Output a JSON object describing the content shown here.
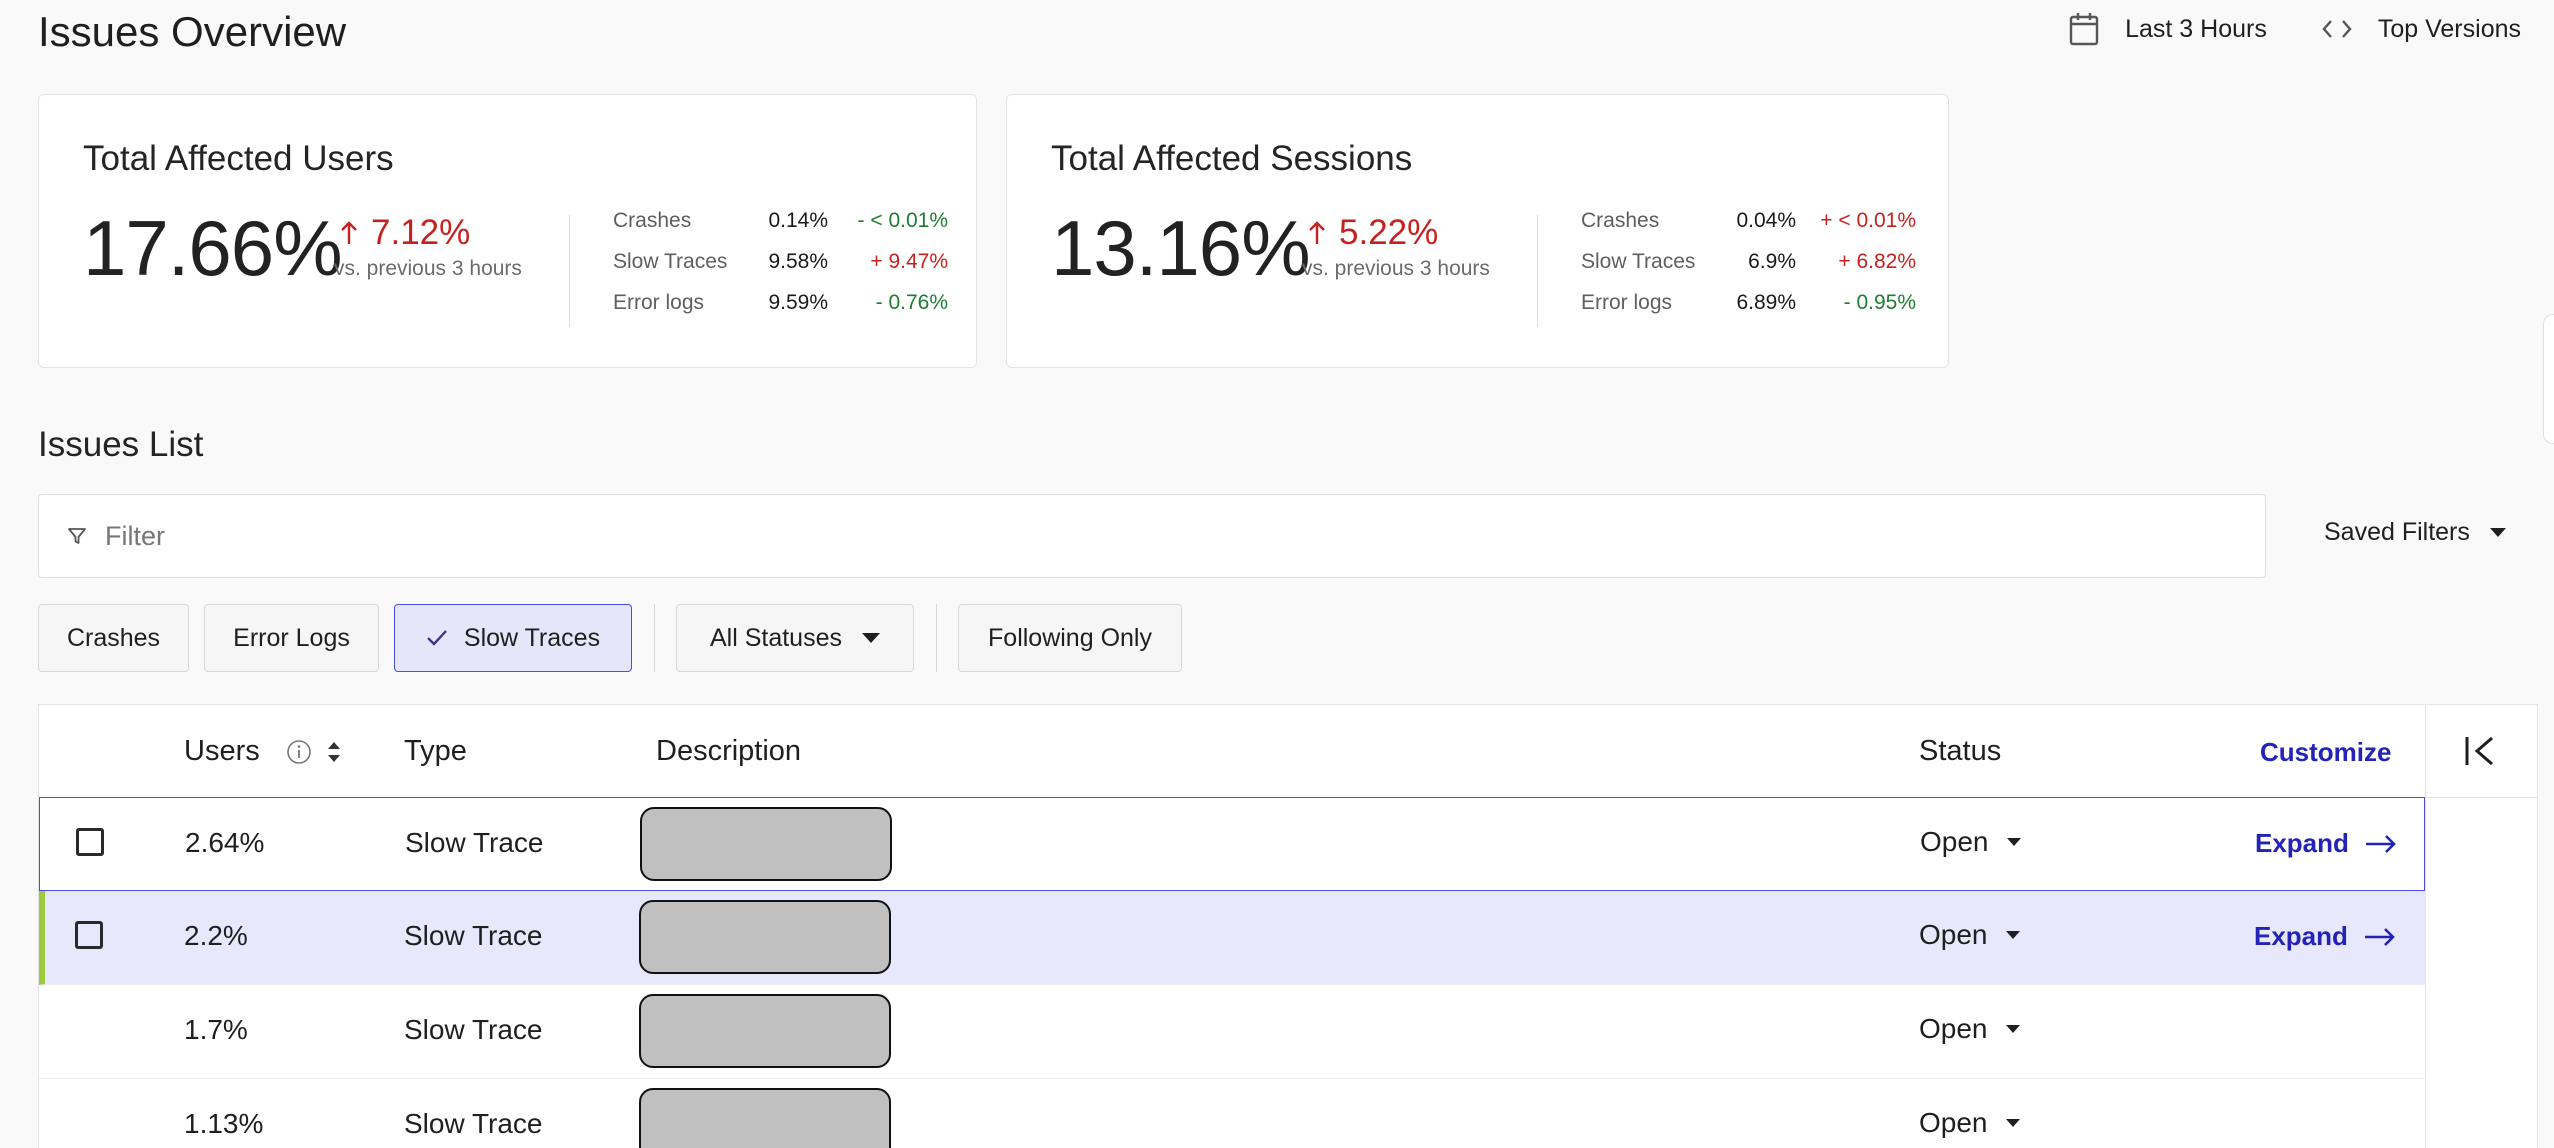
{
  "header": {
    "title": "Issues Overview",
    "time_range": "Last 3 Hours",
    "versions": "Top Versions"
  },
  "cards": [
    {
      "title": "Total Affected Users",
      "value": "17.66%",
      "delta": "7.12%",
      "delta_direction": "up",
      "comparison": "vs. previous 3 hours",
      "breakdown": [
        {
          "label": "Crashes",
          "value": "0.14%",
          "change": "- < 0.01%",
          "trend": "down"
        },
        {
          "label": "Slow Traces",
          "value": "9.58%",
          "change": "+ 9.47%",
          "trend": "up"
        },
        {
          "label": "Error logs",
          "value": "9.59%",
          "change": "- 0.76%",
          "trend": "down"
        }
      ]
    },
    {
      "title": "Total Affected Sessions",
      "value": "13.16%",
      "delta": "5.22%",
      "delta_direction": "up",
      "comparison": "vs. previous 3 hours",
      "breakdown": [
        {
          "label": "Crashes",
          "value": "0.04%",
          "change": "+ < 0.01%",
          "trend": "up"
        },
        {
          "label": "Slow Traces",
          "value": "6.9%",
          "change": "+ 6.82%",
          "trend": "up"
        },
        {
          "label": "Error logs",
          "value": "6.89%",
          "change": "- 0.95%",
          "trend": "down"
        }
      ]
    }
  ],
  "issues": {
    "title": "Issues List",
    "filter_placeholder": "Filter",
    "saved_filters": "Saved Filters",
    "chips": {
      "crashes": "Crashes",
      "error_logs": "Error Logs",
      "slow_traces": "Slow Traces",
      "all_statuses": "All Statuses",
      "following_only": "Following Only"
    },
    "columns": {
      "users": "Users",
      "type": "Type",
      "description": "Description",
      "status": "Status",
      "customize": "Customize"
    },
    "rows": [
      {
        "users": "2.64%",
        "type": "Slow Trace",
        "status": "Open",
        "action": "Expand"
      },
      {
        "users": "2.2%",
        "type": "Slow Trace",
        "status": "Open",
        "action": "Expand"
      },
      {
        "users": "1.7%",
        "type": "Slow Trace",
        "status": "Open",
        "action": ""
      },
      {
        "users": "1.13%",
        "type": "Slow Trace",
        "status": "Open",
        "action": ""
      }
    ]
  },
  "colors": {
    "accent": "#2323b8",
    "selected_chip_bg": "#e6e6fb",
    "highlight_row_bg": "#e7e8fb",
    "highlight_row_marker": "#9ccb3b",
    "negative": "#c5221f",
    "positive": "#1e7d32"
  }
}
